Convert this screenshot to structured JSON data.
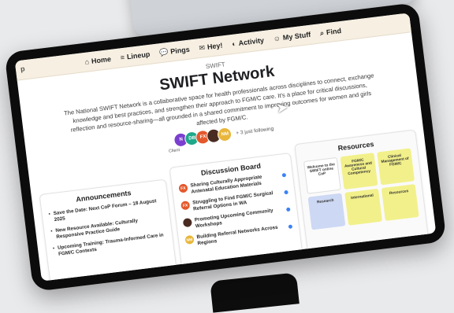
{
  "nav": {
    "edge_label": "p",
    "items": [
      {
        "label": "Home",
        "icon": "home-icon",
        "glyph": "⌂"
      },
      {
        "label": "Lineup",
        "icon": "lineup-icon",
        "glyph": "≡"
      },
      {
        "label": "Pings",
        "icon": "chat-icon",
        "glyph": "💬"
      },
      {
        "label": "Hey!",
        "icon": "inbox-icon",
        "glyph": "✉"
      },
      {
        "label": "Activity",
        "icon": "activity-icon",
        "glyph": "◐"
      },
      {
        "label": "My Stuff",
        "icon": "smiley-icon",
        "glyph": "☺"
      },
      {
        "label": "Find",
        "icon": "search-icon",
        "glyph": "⌕"
      }
    ]
  },
  "hero": {
    "eyebrow": "SWIFT",
    "title": "SWIFT Network",
    "description": "The National SWIFT Network is a collaborative space for health professionals across disciplines to connect, exchange knowledge and best practices, and strengthen their approach to FGM/C care. It's a place for critical discussions, reflection and resource-sharing—all grounded in a shared commitment to improving outcomes for women and girls affected by FGM/C."
  },
  "people": {
    "avatars": [
      {
        "initials": "N",
        "color": "#7b3fd0"
      },
      {
        "initials": "DB",
        "color": "#1fa88a"
      },
      {
        "initials": "FX",
        "color": "#e4582c"
      },
      {
        "initials": "",
        "color": "#4a2b22"
      },
      {
        "initials": "NM",
        "color": "#e8b63a"
      }
    ],
    "following": "+ 3 just following",
    "client_label": "Client"
  },
  "announcements": {
    "title": "Announcements",
    "items": [
      "Save the Date: Next CoP Forum – 18 August 2025",
      "New Resource Available: Culturally Responsive Practice Guide",
      "Upcoming Training: Trauma-Informed Care in FGM/C Contexts"
    ]
  },
  "discussion": {
    "title": "Discussion Board",
    "items": [
      {
        "tag": "FX",
        "text": "Sharing Culturally Appropriate Antenatal Education Materials"
      },
      {
        "tag": "FX",
        "text": "Struggling to Find FGM/C Surgical Referral Options in WA"
      },
      {
        "tag": "",
        "text": "Promoting Upcoming Community Workshops"
      },
      {
        "tag": "NM",
        "text": "Building Referral Networks Across Regions"
      }
    ]
  },
  "resources": {
    "title": "Resources",
    "tiles": [
      {
        "label": "Welcome to the SWIFT online CoP",
        "color": "#ffffff"
      },
      {
        "label": "FGM/C Awareness and Cultural Competency",
        "color": "#f2f08a"
      },
      {
        "label": "Clinical Management of FGM/C",
        "color": "#f2f08a"
      },
      {
        "label": "Research",
        "color": "#cdd8f4"
      },
      {
        "label": "International",
        "color": "#f2f08a"
      },
      {
        "label": "Resources",
        "color": "#f2f08a"
      }
    ]
  }
}
